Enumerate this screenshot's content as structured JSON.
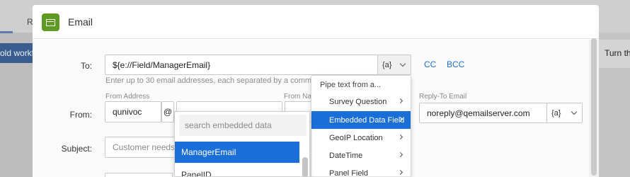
{
  "background": {
    "tab_fragment": "R",
    "button_fragment": "old workfl",
    "right_text": "Turn th"
  },
  "modal": {
    "title": "Email",
    "icon": "mail-icon"
  },
  "to": {
    "label": "To:",
    "value": "${e://Field/ManagerEmail}",
    "hint": "Enter up to 30 email addresses, each separated by a comm",
    "pipe_label": "{a}",
    "cc": "CC",
    "bcc": "BCC"
  },
  "from": {
    "label": "From:",
    "from_address_label": "From Address",
    "from_name_label": "From Na",
    "address_value": "qunivoc",
    "at": "@",
    "reply_to_label": "Reply-To Email",
    "reply_to_value": "noreply@qemailserver.com",
    "reply_pipe_label": "{a}"
  },
  "subject": {
    "label": "Subject:",
    "value": "Customer needs fo"
  },
  "pipe_menu": {
    "header": "Pipe text from a...",
    "items": [
      {
        "label": "Survey Question"
      },
      {
        "label": "Embedded Data Field"
      },
      {
        "label": "GeoIP Location"
      },
      {
        "label": "DateTime"
      },
      {
        "label": "Panel Field"
      }
    ],
    "active_index": 1
  },
  "embedded_menu": {
    "search_placeholder": "search embedded data",
    "items": [
      {
        "label": "ManagerEmail"
      },
      {
        "label": "PanelID"
      }
    ],
    "active_index": 0
  },
  "colors": {
    "accent": "#1a6ed8",
    "icon_green": "#5f9b22",
    "link": "#1e6fd0"
  }
}
